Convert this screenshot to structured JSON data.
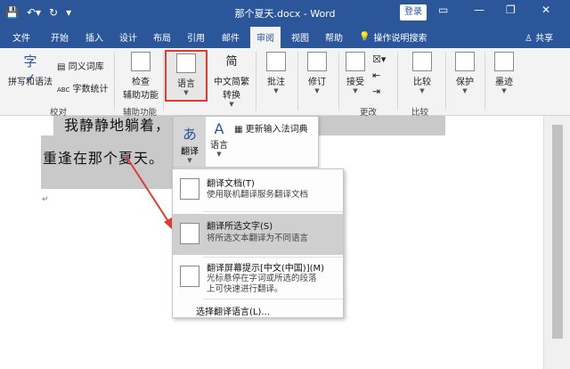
{
  "titlebar": {
    "document_title": "那个夏天.docx - Word",
    "login_label": "登录",
    "icons": [
      "save-icon",
      "undo-icon",
      "redo-icon",
      "customize-qat-icon"
    ]
  },
  "tabs": [
    "文件",
    "开始",
    "插入",
    "设计",
    "布局",
    "引用",
    "邮件",
    "审阅",
    "视图",
    "帮助"
  ],
  "active_tab": "审阅",
  "tell_me": "操作说明搜索",
  "share": "共享",
  "ribbon": {
    "proofing": {
      "spelling": "拼写和语法",
      "thesaurus": "同义词库",
      "word_count": "字数统计",
      "group": "校对"
    },
    "accessibility": {
      "check_line1": "检查",
      "check_line2": "辅助功能",
      "group": "辅助功能"
    },
    "language": {
      "label": "语言"
    },
    "chinese_conv": {
      "line1": "中文简繁",
      "line2": "转换"
    },
    "comments": {
      "label": "批注"
    },
    "tracking": {
      "label": "修订"
    },
    "changes": {
      "accept": "接受",
      "group": "更改"
    },
    "compare": {
      "label": "比较",
      "group": "比较"
    },
    "protect": {
      "label": "保护"
    },
    "ink": {
      "label": "墨迹"
    }
  },
  "document": {
    "line1": "我静静地躺着，          ，等着有一天我们",
    "line2": "重逢在那个夏天。"
  },
  "language_panel": {
    "translate": "翻译",
    "language": "语言",
    "update_ime": "更新输入法词典"
  },
  "translate_menu": {
    "items": [
      {
        "title": "翻译文档(T)",
        "desc": "使用联机翻译服务翻译文档"
      },
      {
        "title": "翻译所选文字(S)",
        "desc": "将所选文本翻译为不同语言"
      },
      {
        "title": "翻译屏幕提示[中文(中国)](M)",
        "desc1": "光标悬停在字词或所选的段落",
        "desc2": "上可快速进行翻译。"
      }
    ],
    "choose_language": "选择翻译语言(L)..."
  },
  "colors": {
    "accent": "#2b579a",
    "highlight_box": "#e03b2f",
    "annotation_arrow": "#e03b2f"
  }
}
